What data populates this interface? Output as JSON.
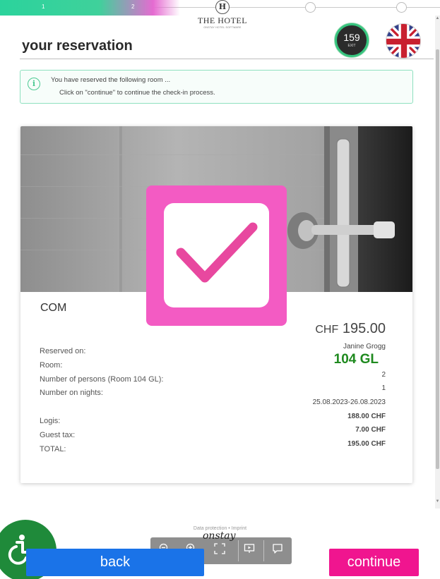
{
  "progress": {
    "steps": [
      "1",
      "2"
    ],
    "accent_from": "#2bd39c",
    "accent_to": "#f056d3"
  },
  "logo": {
    "mark": "H",
    "name": "THE HOTEL",
    "tagline": "ONSTAY HOTEL SOFTWARE"
  },
  "header": {
    "title": "your reservation",
    "exit": {
      "count": "159",
      "label": "EXIT",
      "ring_color": "#36c47e"
    },
    "language_flag": "uk-flag-icon"
  },
  "info": {
    "icon": "info-icon",
    "line1": "You have reserved the following room ...",
    "line2": "Click on \"continue\" to continue the check-in process."
  },
  "reservation": {
    "room_name": "COM",
    "currency": "CHF",
    "amount": "195.00",
    "guest_name": "Janine Grogg",
    "room_number": "104 GL",
    "labels": {
      "reserved_on": "Reserved on:",
      "room": "Room:",
      "persons": "Number of persons (Room 104 GL):",
      "nights": "Number on nights:",
      "logis": "Logis:",
      "guest_tax": "Guest tax:",
      "total": "TOTAL:"
    },
    "values": {
      "persons": "2",
      "nights": "1",
      "dates": "25.08.2023-26.08.2023",
      "logis": "188.00 CHF",
      "guest_tax": "7.00 CHF",
      "total": "195.00 CHF"
    },
    "check_color": "#f35bc3"
  },
  "footer": {
    "legal": "Data protection • Imprint",
    "brand": "onstay",
    "toolbar_icons": [
      "zoom-out-icon",
      "zoom-in-icon",
      "fullscreen-icon",
      "presentation-icon",
      "comment-icon"
    ],
    "back_label": "back",
    "continue_label": "continue",
    "back_color": "#1a73e8",
    "continue_color": "#f0158f"
  }
}
